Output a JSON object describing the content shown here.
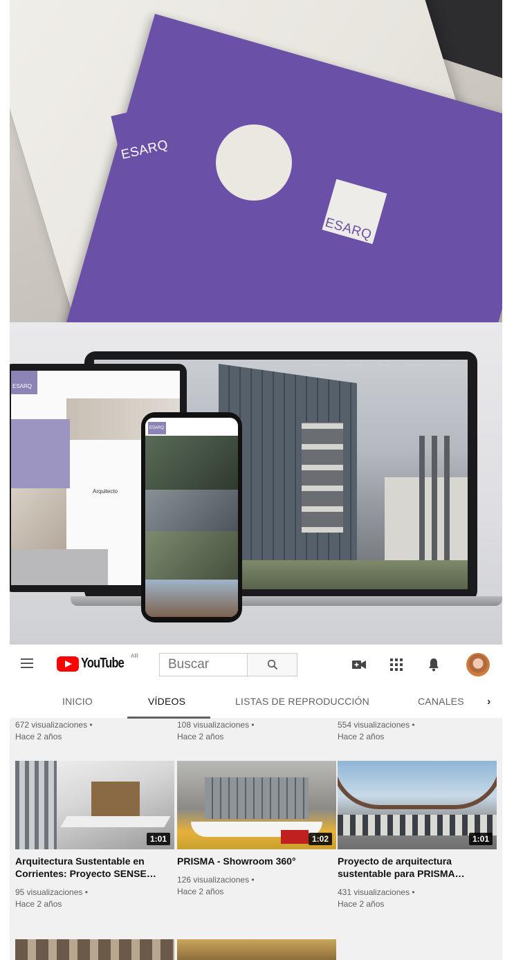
{
  "photo_folder": {
    "logo_left": "ESARQ",
    "logo_right": "ESARQ",
    "colors": {
      "purple": "#6a50a6",
      "paper": "#eceae5"
    }
  },
  "photo_devices": {
    "tablet_logo": "ESARQ",
    "phone_logo": "ESARQ",
    "tablet_heading": "Arquitecto"
  },
  "youtube": {
    "logo_word": "YouTube",
    "region": "AR",
    "search_placeholder": "Buscar",
    "header_icons": [
      "menu-icon",
      "create-video-icon",
      "apps-grid-icon",
      "notifications-icon"
    ],
    "tabs": [
      {
        "label": "INICIO",
        "active": false
      },
      {
        "label": "VÍDEOS",
        "active": true
      },
      {
        "label": "LISTAS DE REPRODUCCIÓN",
        "active": false
      },
      {
        "label": "CANALES",
        "active": false
      }
    ],
    "tab_more": "›",
    "prev_row": [
      {
        "views": "672 visualizaciones •",
        "age": "Hace 2 años"
      },
      {
        "views": "108 visualizaciones •",
        "age": "Hace 2 años"
      },
      {
        "views": "554 visualizaciones •",
        "age": "Hace 2 años"
      }
    ],
    "videos": [
      {
        "title_line1": "Arquitectura Sustentable en",
        "title_line2": "Corrientes: Proyecto SENSE…",
        "duration": "1:01",
        "views": "95 visualizaciones •",
        "age": "Hace 2 años"
      },
      {
        "title_line1": "PRISMA - Showroom 360°",
        "title_line2": "",
        "duration": "1:02",
        "views": "126 visualizaciones •",
        "age": "Hace 2 años"
      },
      {
        "title_line1": "Proyecto de arquitectura",
        "title_line2": "sustentable para PRISMA…",
        "duration": "1:01",
        "views": "431 visualizaciones •",
        "age": "Hace 2 años"
      }
    ],
    "colors": {
      "brand_red": "#ff0000",
      "page_bg": "#f1f1f1"
    }
  }
}
